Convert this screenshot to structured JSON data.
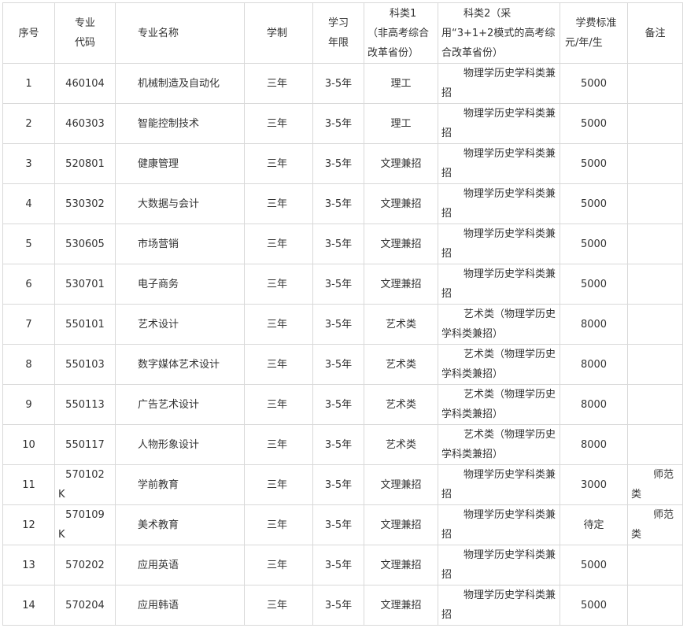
{
  "headers": {
    "index": "序号",
    "code_1": "专业",
    "code_2": "代码",
    "name": "专业名称",
    "system": "学制",
    "duration_1": "学习",
    "duration_2": "年限",
    "subject1": "科类1（非高考综合改革省份）",
    "subject2": "科类2（采用“3+1+2模式的高考综合改革省份）",
    "fee_1": "学费标准",
    "fee_2": "元/年/生",
    "remark": "备注"
  },
  "rows": [
    {
      "index": "1",
      "code": "460104",
      "code_suffix": "",
      "name": "机械制造及自动化",
      "system": "三年",
      "duration": "3-5年",
      "subject1": "理工",
      "subject2": "物理学历史学科类兼招",
      "fee": "5000",
      "remark": ""
    },
    {
      "index": "2",
      "code": "460303",
      "code_suffix": "",
      "name": "智能控制技术",
      "system": "三年",
      "duration": "3-5年",
      "subject1": "理工",
      "subject2": "物理学历史学科类兼招",
      "fee": "5000",
      "remark": ""
    },
    {
      "index": "3",
      "code": "520801",
      "code_suffix": "",
      "name": "健康管理",
      "system": "三年",
      "duration": "3-5年",
      "subject1": "文理兼招",
      "subject2": "物理学历史学科类兼招",
      "fee": "5000",
      "remark": ""
    },
    {
      "index": "4",
      "code": "530302",
      "code_suffix": "",
      "name": "大数据与会计",
      "system": "三年",
      "duration": "3-5年",
      "subject1": "文理兼招",
      "subject2": "物理学历史学科类兼招",
      "fee": "5000",
      "remark": ""
    },
    {
      "index": "5",
      "code": "530605",
      "code_suffix": "",
      "name": "市场营销",
      "system": "三年",
      "duration": "3-5年",
      "subject1": "文理兼招",
      "subject2": "物理学历史学科类兼招",
      "fee": "5000",
      "remark": ""
    },
    {
      "index": "6",
      "code": "530701",
      "code_suffix": "",
      "name": "电子商务",
      "system": "三年",
      "duration": "3-5年",
      "subject1": "文理兼招",
      "subject2": "物理学历史学科类兼招",
      "fee": "5000",
      "remark": ""
    },
    {
      "index": "7",
      "code": "550101",
      "code_suffix": "",
      "name": "艺术设计",
      "system": "三年",
      "duration": "3-5年",
      "subject1": "艺术类",
      "subject2": "艺术类（物理学历史学科类兼招）",
      "fee": "8000",
      "remark": ""
    },
    {
      "index": "8",
      "code": "550103",
      "code_suffix": "",
      "name": "数字媒体艺术设计",
      "system": "三年",
      "duration": "3-5年",
      "subject1": "艺术类",
      "subject2": "艺术类（物理学历史学科类兼招）",
      "fee": "8000",
      "remark": ""
    },
    {
      "index": "9",
      "code": "550113",
      "code_suffix": "",
      "name": "广告艺术设计",
      "system": "三年",
      "duration": "3-5年",
      "subject1": "艺术类",
      "subject2": "艺术类（物理学历史学科类兼招）",
      "fee": "8000",
      "remark": ""
    },
    {
      "index": "10",
      "code": "550117",
      "code_suffix": "",
      "name": "人物形象设计",
      "system": "三年",
      "duration": "3-5年",
      "subject1": "艺术类",
      "subject2": "艺术类（物理学历史学科类兼招）",
      "fee": "8000",
      "remark": ""
    },
    {
      "index": "11",
      "code": "570102",
      "code_suffix": "K",
      "name": "学前教育",
      "system": "三年",
      "duration": "3-5年",
      "subject1": "文理兼招",
      "subject2": "物理学历史学科类兼招",
      "fee": "3000",
      "remark": "师范类"
    },
    {
      "index": "12",
      "code": "570109",
      "code_suffix": "K",
      "name": "美术教育",
      "system": "三年",
      "duration": "3-5年",
      "subject1": "文理兼招",
      "subject2": "物理学历史学科类兼招",
      "fee": "待定",
      "remark": "师范类"
    },
    {
      "index": "13",
      "code": "570202",
      "code_suffix": "",
      "name": "应用英语",
      "system": "三年",
      "duration": "3-5年",
      "subject1": "文理兼招",
      "subject2": "物理学历史学科类兼招",
      "fee": "5000",
      "remark": ""
    },
    {
      "index": "14",
      "code": "570204",
      "code_suffix": "",
      "name": "应用韩语",
      "system": "三年",
      "duration": "3-5年",
      "subject1": "文理兼招",
      "subject2": "物理学历史学科类兼招",
      "fee": "5000",
      "remark": ""
    }
  ]
}
